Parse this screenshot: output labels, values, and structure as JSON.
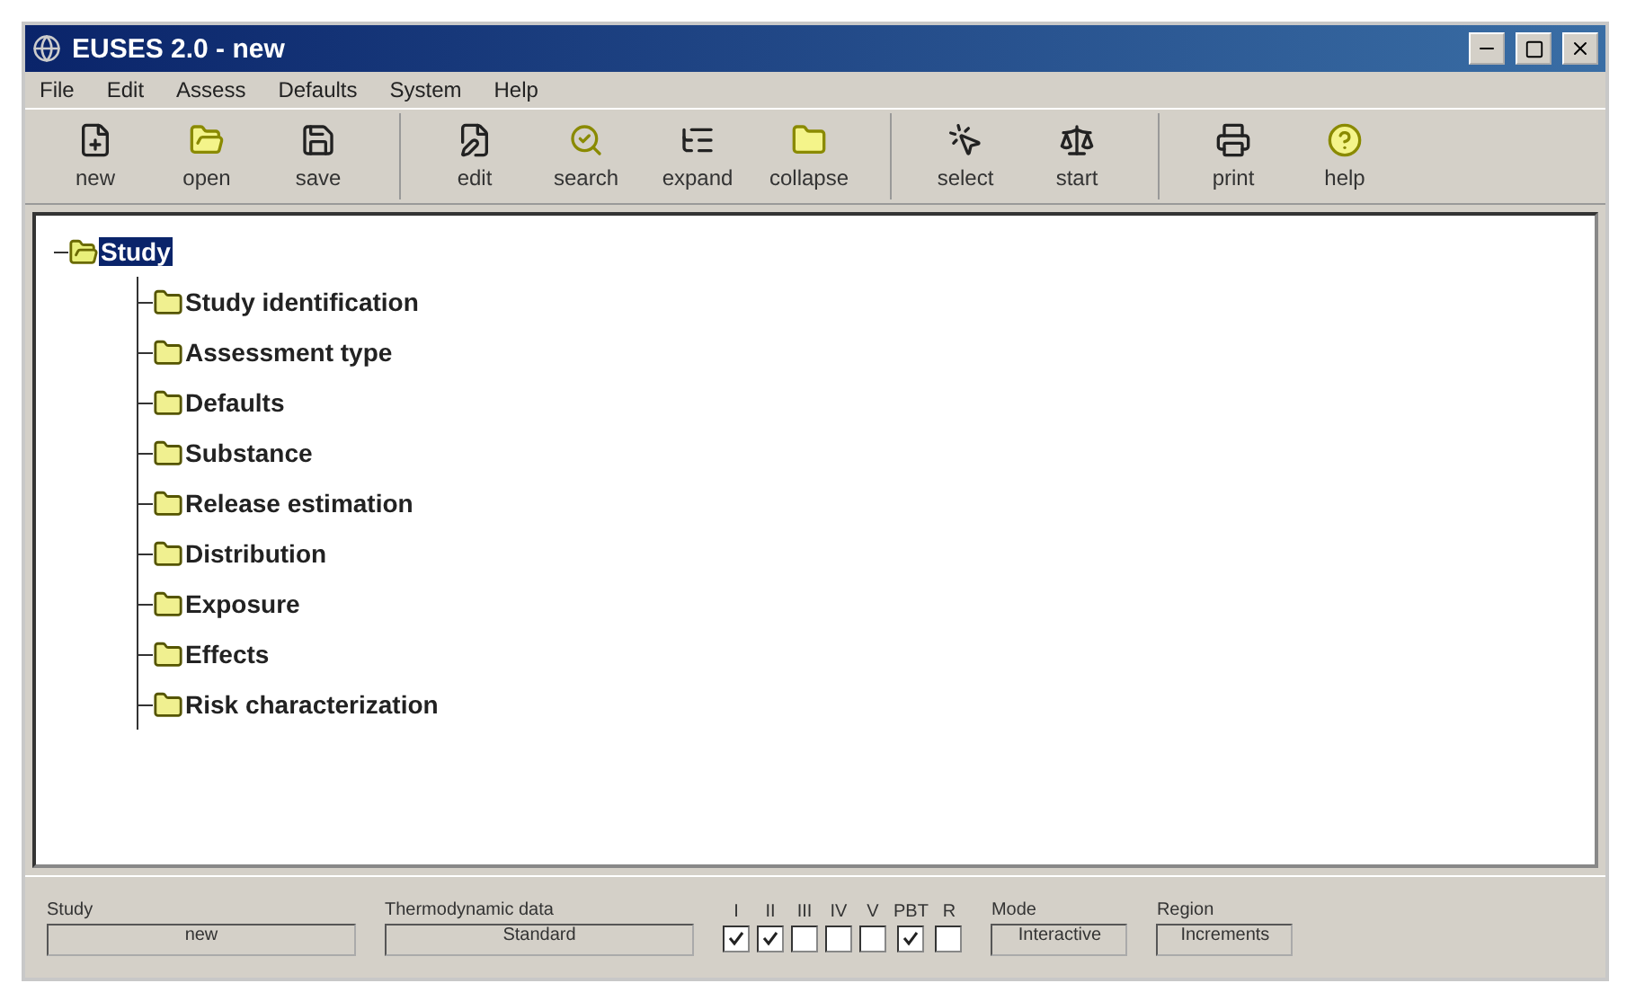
{
  "window": {
    "title": "EUSES 2.0 - new"
  },
  "menu": [
    "File",
    "Edit",
    "Assess",
    "Defaults",
    "System",
    "Help"
  ],
  "toolbar": [
    [
      {
        "label": "new"
      },
      {
        "label": "open"
      },
      {
        "label": "save"
      }
    ],
    [
      {
        "label": "edit"
      },
      {
        "label": "search"
      },
      {
        "label": "expand"
      },
      {
        "label": "collapse"
      }
    ],
    [
      {
        "label": "select"
      },
      {
        "label": "start"
      }
    ],
    [
      {
        "label": "print"
      },
      {
        "label": "help"
      }
    ]
  ],
  "tree": {
    "label": "Study",
    "selected": true,
    "expanded": true,
    "children": [
      {
        "label": "Study identification",
        "selected": false
      },
      {
        "label": "Assessment type",
        "selected": false
      },
      {
        "label": "Defaults",
        "selected": false
      },
      {
        "label": "Substance",
        "selected": false
      },
      {
        "label": "Release estimation",
        "selected": false
      },
      {
        "label": "Distribution",
        "selected": false
      },
      {
        "label": "Exposure",
        "selected": false
      },
      {
        "label": "Effects",
        "selected": false
      },
      {
        "label": "Risk characterization",
        "selected": false
      }
    ]
  },
  "status_bar": {
    "fields": [
      {
        "label": "Study",
        "value": "new"
      },
      {
        "label": "Thermodynamic data",
        "value": "Standard"
      }
    ],
    "checks": [
      {
        "label": "I",
        "checked": true
      },
      {
        "label": "II",
        "checked": true
      },
      {
        "label": "III",
        "checked": false
      },
      {
        "label": "IV",
        "checked": false
      },
      {
        "label": "V",
        "checked": false
      },
      {
        "label": "PBT",
        "checked": true
      },
      {
        "label": "R",
        "checked": false
      }
    ],
    "fields_2": [
      {
        "label": "Mode",
        "value": "Interactive"
      },
      {
        "label": "Region",
        "value": "Increments"
      }
    ]
  }
}
